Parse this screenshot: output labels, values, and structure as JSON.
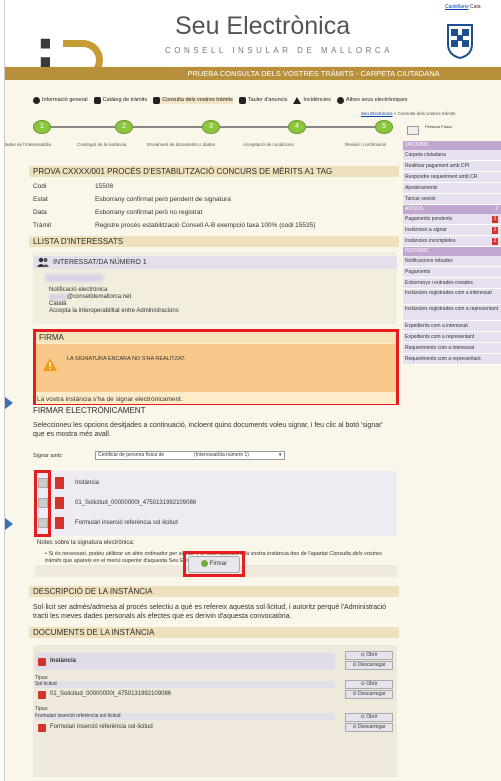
{
  "header": {
    "site_title": "Seu Electrònica",
    "site_subtitle": "CONSELL INSULAR DE MALLORCA",
    "top_link_1": "Castellano",
    "top_link_2": "Cata",
    "title_bar": "PRUEBA CONSULTA DELS VOSTRES TRÀMITS - CARPETA CIUTADANA"
  },
  "menu": [
    {
      "label": "Informació general"
    },
    {
      "label": "Catàleg de tràmits"
    },
    {
      "label": "Consulta dels vostres tràmits"
    },
    {
      "label": "Tauler d'anuncis"
    },
    {
      "label": "Incidències"
    },
    {
      "label": "Altres seus electròniques"
    }
  ],
  "breadcrumb": {
    "root": "Seu Electrònica",
    "rest": " > Consulta dels vostres tràmits"
  },
  "steps": [
    {
      "num": "1",
      "label": "lades de l'interessat/da"
    },
    {
      "num": "2",
      "label": "Contingut de la instància"
    },
    {
      "num": "3",
      "label": "Enviament de documents o dades"
    },
    {
      "num": "4",
      "label": "Acceptació de condicions"
    },
    {
      "num": "5",
      "label": "Revisió i confirmació"
    }
  ],
  "procedure": {
    "title": "PROVA CXXXX/001 PROCÉS D'ESTABILITZACIÓ CONCURS DE MÈRITS A1 TAG",
    "rows": [
      {
        "key": "Codi",
        "value": "15508"
      },
      {
        "key": "Estat",
        "value": "Esborrany confirmat però pendent de signatura"
      },
      {
        "key": "Data",
        "value": "Esborrany confirmat però no registrat"
      },
      {
        "key": "Tràmit",
        "value": "Registre procés estabilització Consell A-B exempció taxa 100% (codi 15535)"
      }
    ]
  },
  "interested": {
    "section": "LLISTA D'INTERESSATS",
    "heading": "INTERESSAT/DA NÚMERO 1",
    "notification": "Notificació electrònica",
    "email": "@conselldemallorca.net",
    "language": "Català",
    "interop": "Accepta la interoperabilitat entre Administracions"
  },
  "firma": {
    "section": "FIRMA",
    "warning": "LA SIGNATURA ENCARA NO S'HA REALITZAT.",
    "message": "La vostra instància s'ha de signar electrònicament."
  },
  "sign": {
    "section": "FIRMAR ELECTRÒNICAMENT",
    "intro": "Seleccioneu les opcions desitjades a continuació, incloent quins documents voleu signar, i feu clic al botó 'signar' que es mostra més avall.",
    "sign_with_label": "Signar amb:",
    "cert_option": "Certificat de persona física de",
    "cert_target": "(Interessat/da número 1)",
    "documents": [
      {
        "name": "Instància"
      },
      {
        "name": "01_Solicitud_00000000t_4750131992109086"
      },
      {
        "name": "Formulari inserció referència sol·licitud"
      }
    ],
    "notes_title": "Notes sobre la signatura electrònica:",
    "note_part1": "Si és necessari, podeu utilitzar un altre ordinador per signar. Per això, accediu a la vostra instància des de l'apartat ",
    "note_italic": "Consulta dels vostres tràmits",
    "note_part2": " que apareix en el menú superior d'aquesta Seu Electrònica.",
    "button": "Firmar"
  },
  "description": {
    "section": "DESCRIPCIÓ DE LA INSTÀNCIA",
    "text": "Sol·licit ser admès/admesa al procés selectiu a què es refereix aquesta sol·licitud, i autoritz perquè l'Administració tracti les meves dades personals als efectes que es derivin d'aquesta convocatòria."
  },
  "docs": {
    "section": "DOCUMENTS DE LA INSTÀNCIA",
    "open": "Obrir",
    "download": "Descarregar",
    "items": [
      {
        "name": "Instància",
        "type_label": "",
        "type_value": ""
      },
      {
        "name": "01_Solicitud_00000000t_4750131992109086",
        "type_label": "Tipus:",
        "type_value": "Sol·licitud"
      },
      {
        "name": "Formulari inserció referència sol·licitud",
        "type_label": "Tipus:",
        "type_value": "Formulari inserció referència sol·licitud"
      }
    ]
  },
  "sidebar": {
    "user": "Persona Física",
    "options_head": "OPCIONS",
    "options": [
      "Carpeta ciutadana",
      "Realitzar pagament amb CPI",
      "Respondre requeriment amb CR",
      "Apoderaments",
      "Tancar sessió"
    ],
    "avisos_head": "AVISOS",
    "avisos_count": "2",
    "avisos": [
      {
        "label": "Pagaments pendents",
        "count": "1"
      },
      {
        "label": "Instàncies a signar",
        "count": "1"
      },
      {
        "label": "Instàncies incompletes",
        "count": "2"
      }
    ],
    "history_head": "HISTÒRIC",
    "history": [
      "Notificacions rebudes",
      "Pagaments",
      "Esborranys i entrades creades",
      "Instàncies registrades com a interessat",
      "Instàncies registrades com a representant",
      "Expedients com a interessat",
      "Expedients com a representant",
      "Requeriments com a interessat",
      "Requeriments com a representant"
    ]
  }
}
